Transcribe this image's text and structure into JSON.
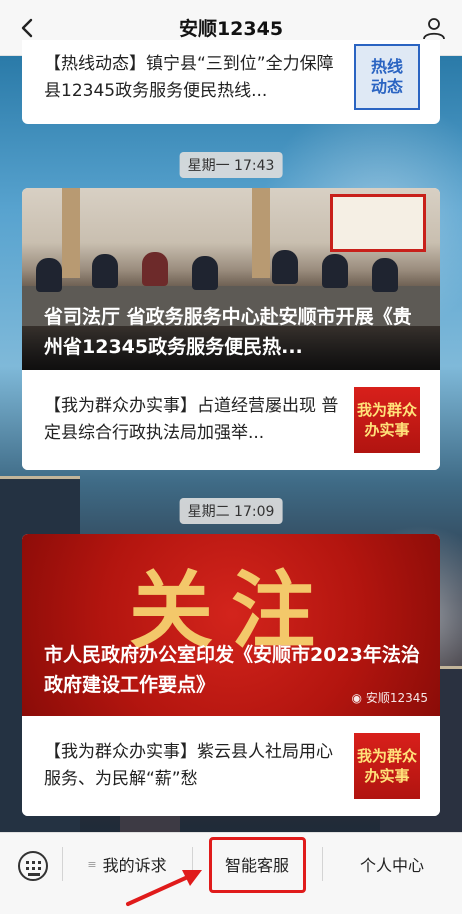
{
  "header": {
    "title": "安顺12345"
  },
  "feed": {
    "card0": {
      "text": "【热线动态】镇宁县“三到位”全力保障县12345政务服务便民热线...",
      "thumb": "热线\n动态"
    },
    "time1": "星期一 17:43",
    "card1": {
      "hero_caption": "省司法厅 省政务服务中心赴安顺市开展《贵州省12345政务服务便民热...",
      "item_text": "【我为群众办实事】占道经营屡出现 普定县综合行政执法局加强举...",
      "item_thumb": "我为群众\n办实事"
    },
    "time2": "星期二 17:09",
    "card2": {
      "hero_big": "关注",
      "hero_caption": "市人民政府办公室印发《安顺市2023年法治政府建设工作要点》",
      "hero_badge": "安顺12345",
      "item_text": "【我为群众办实事】紫云县人社局用心服务、为民解“薪”愁",
      "item_thumb": "我为群众\n办实事"
    }
  },
  "bottom_bar": {
    "tab1": "我的诉求",
    "tab2": "智能客服",
    "tab3": "个人中心"
  },
  "colors": {
    "accent_red": "#e01b1b",
    "header_bg": "#f7f7f7"
  },
  "icons": {
    "back": "chevron-left-icon",
    "profile": "person-icon",
    "keyboard": "keyboard-icon",
    "menu": "menu-lines-icon",
    "annotation": "red-arrow-icon"
  }
}
